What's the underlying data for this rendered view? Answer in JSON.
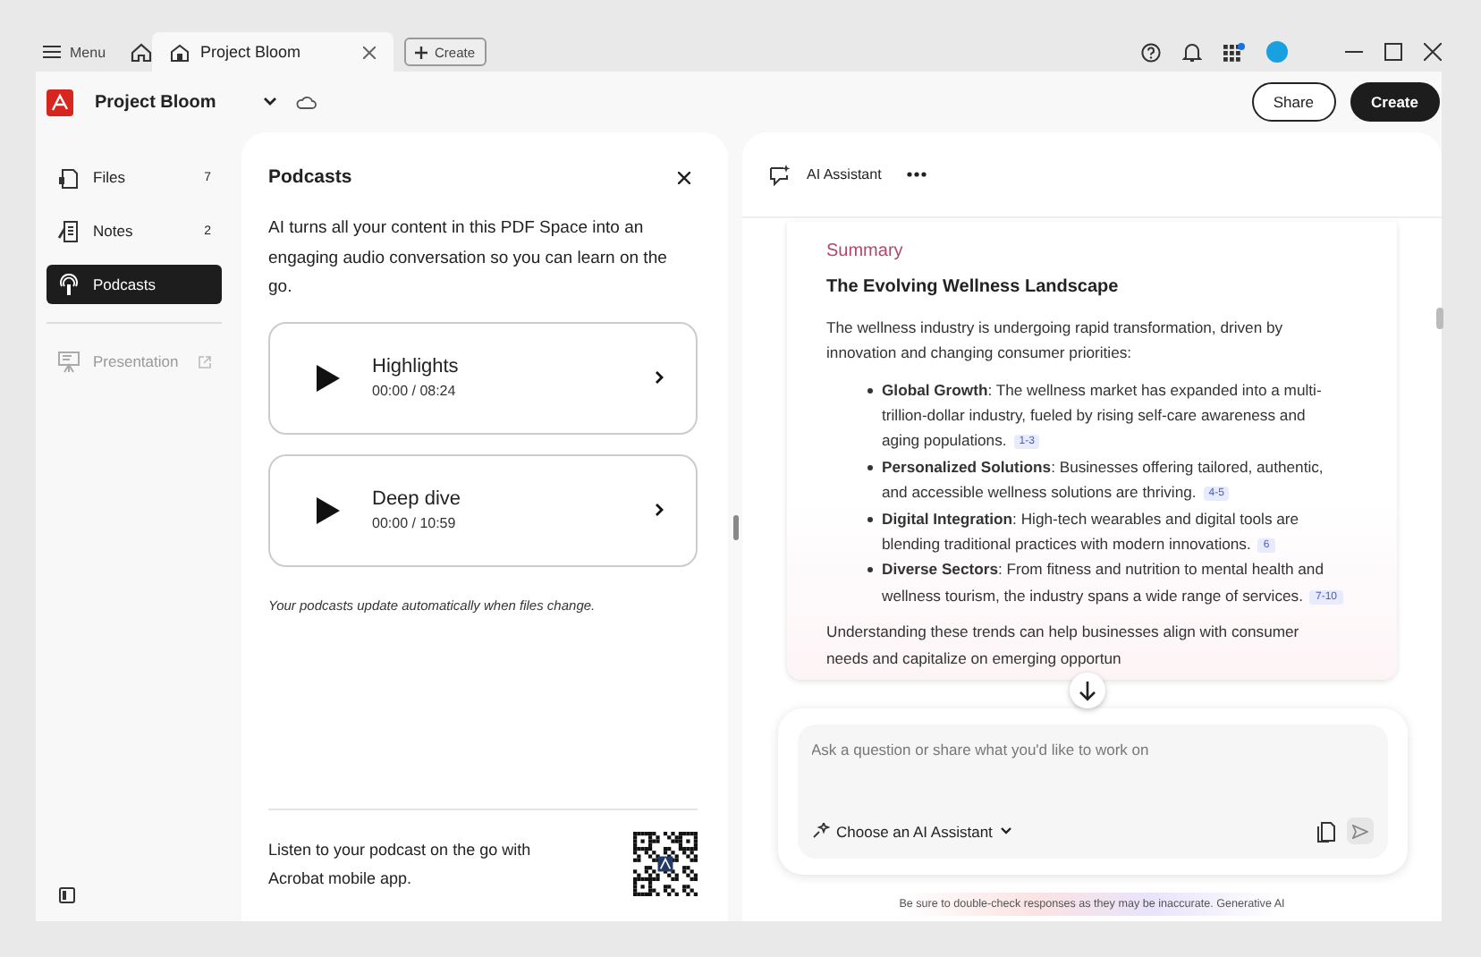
{
  "titlebar": {
    "menu_label": "Menu",
    "tabs": [
      {
        "label": "Project Bloom",
        "selected": true
      }
    ],
    "create_label": "Create"
  },
  "header": {
    "title": "Project Bloom",
    "buttons": [
      {
        "label": "Share",
        "kind": "outline"
      },
      {
        "label": "Create",
        "kind": "primary"
      }
    ]
  },
  "sidebar": {
    "items": [
      {
        "label": "Files",
        "count": "7",
        "selected": false,
        "disabled": false
      },
      {
        "label": "Notes",
        "count": "2",
        "selected": false,
        "disabled": false
      },
      {
        "label": "Podcasts",
        "selected": true,
        "disabled": false
      },
      {
        "label": "Presentation",
        "selected": false,
        "disabled": true
      }
    ]
  },
  "podcasts": {
    "title": "Podcasts",
    "description": "AI turns all your content in this PDF Space into an engaging audio conversation so you can learn on the go.",
    "episodes": [
      {
        "title": "Highlights",
        "time": "00:00 / 08:24"
      },
      {
        "title": "Deep dive",
        "time": "00:00 / 10:59"
      }
    ],
    "note": "Your podcasts update automatically when files change.",
    "footer_text": "Listen to your podcast on the go with Acrobat mobile app."
  },
  "assistant": {
    "title": "AI Assistant",
    "summary": {
      "label": "Summary",
      "heading": "The Evolving Wellness Landscape",
      "intro": "The wellness industry is undergoing rapid transformation, driven by innovation and changing consumer priorities:",
      "bullets": [
        {
          "text": "**Global Growth**: The wellness market has expanded into a multi-trillion-dollar industry, fueled by rising self-care awareness and aging populations.",
          "citation": "1-3"
        },
        {
          "text": "**Personalized Solutions**: Businesses offering tailored, authentic, and accessible wellness solutions are thriving.",
          "citation": "4-5"
        },
        {
          "text": "**Digital Integration**: High-tech wearables and digital tools are blending traditional practices with modern innovations.",
          "citation": "6"
        },
        {
          "text": "**Diverse Sectors**: From fitness and nutrition to mental health and wellness tourism, the industry spans a wide range of services.",
          "citation": "7-10"
        }
      ],
      "closing": "Understanding these trends can help businesses align with consumer needs and capitalize on emerging opportun"
    },
    "input": {
      "placeholder": "Ask a question or share what you'd like to work on",
      "assistant_label": "Choose an AI Assistant"
    },
    "disclaimer": "Be sure to double-check responses as they may be inaccurate.",
    "disclaimer_link": "Generative AI"
  }
}
